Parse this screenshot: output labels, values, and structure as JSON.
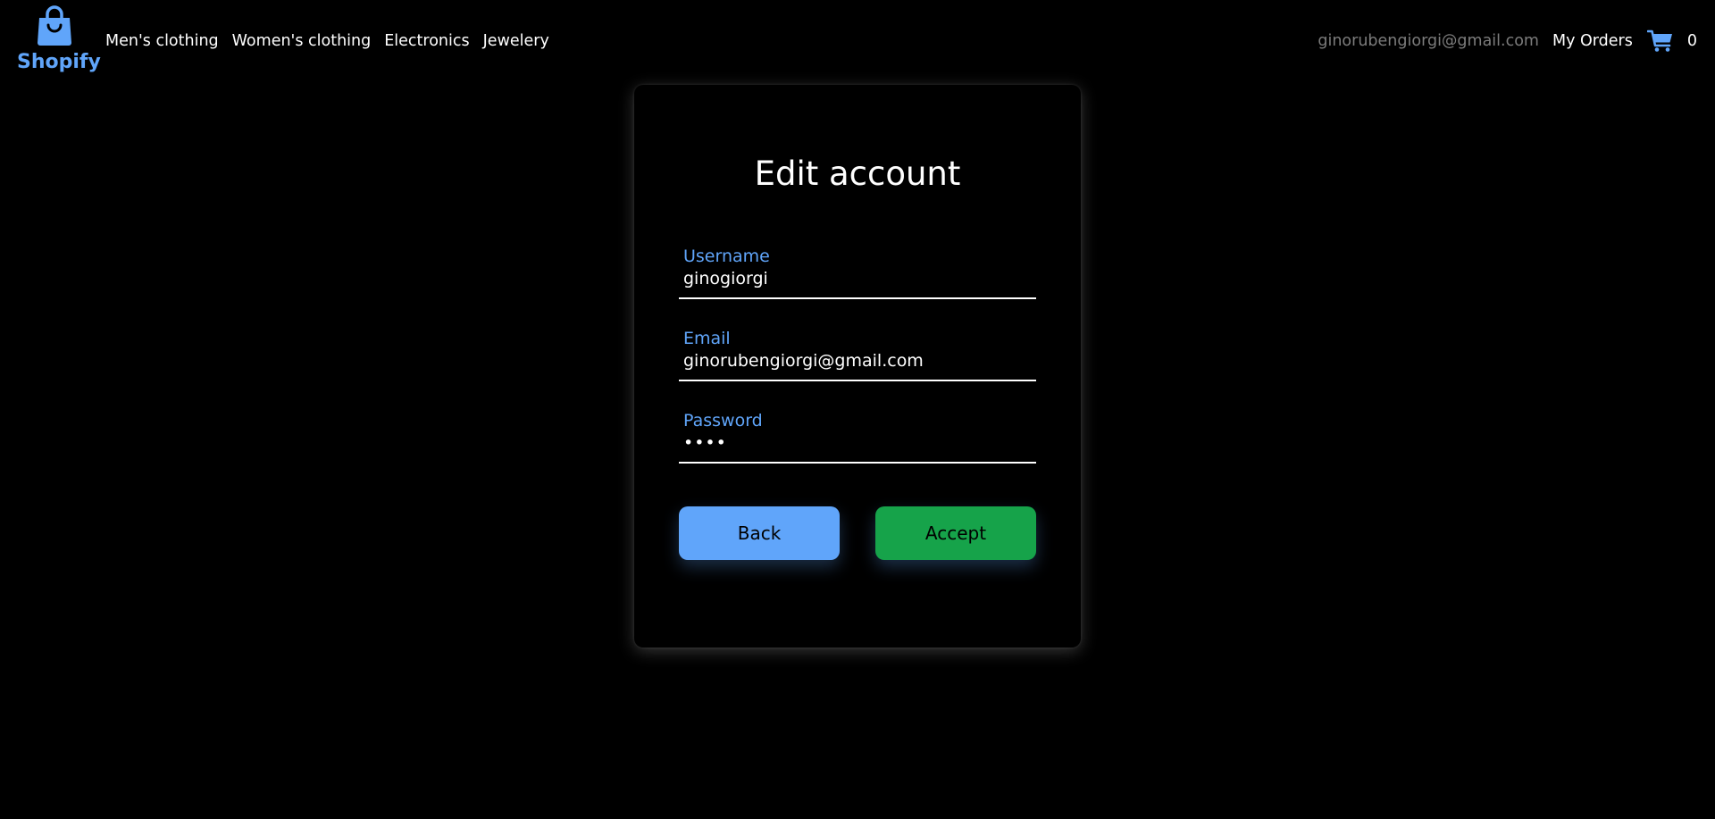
{
  "brand": {
    "name": "Shopify",
    "icon": "shopping-bag-icon",
    "color": "#60a5fa"
  },
  "nav": {
    "links": [
      "Men's clothing",
      "Women's clothing",
      "Electronics",
      "Jewelery"
    ],
    "user_email": "ginorubengiorgi@gmail.com",
    "orders_label": "My Orders",
    "cart_icon": "shopping-cart-icon",
    "cart_count": "0"
  },
  "form": {
    "title": "Edit account",
    "fields": [
      {
        "label": "Username",
        "value": "ginogiorgi",
        "type": "text"
      },
      {
        "label": "Email",
        "value": "ginorubengiorgi@gmail.com",
        "type": "email"
      },
      {
        "label": "Password",
        "value": "1234",
        "type": "password"
      }
    ],
    "back_label": "Back",
    "accept_label": "Accept"
  },
  "colors": {
    "background": "#000000",
    "accent": "#60a5fa",
    "accept": "#16a34a",
    "muted_text": "#7c7c7c"
  }
}
